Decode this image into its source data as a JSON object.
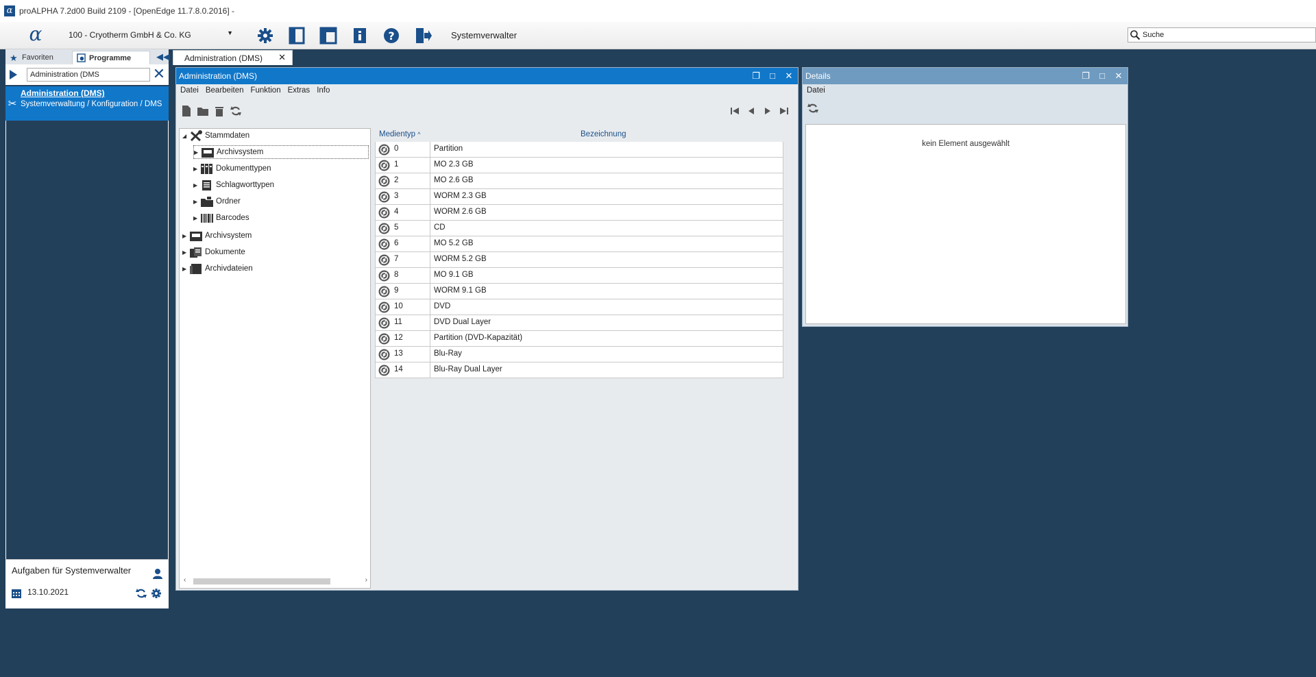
{
  "window": {
    "title": "proALPHA 7.2d00 Build 2109 - [OpenEdge 11.7.8.0.2016] -",
    "app_icon": "alpha-icon"
  },
  "toolbar": {
    "logo": "α",
    "company": "100 - Cryotherm GmbH & Co. KG",
    "role": "Systemverwalter",
    "search_label": "Suche",
    "icons": [
      "gear-icon",
      "panel-icon",
      "layout-icon",
      "info-icon",
      "help-icon",
      "exit-icon"
    ]
  },
  "left_panel": {
    "tabs": [
      {
        "label": "Favoriten",
        "icon": "star-icon"
      },
      {
        "label": "Programme",
        "icon": "programs-icon"
      }
    ],
    "search_value": "Administration (DMS",
    "result": {
      "title": "Administration (DMS)",
      "path": "Systemverwaltung / Konfiguration / DMS"
    },
    "tasks": {
      "title": "Aufgaben für Systemverwalter",
      "date": "13.10.2021"
    }
  },
  "main_tab": {
    "label": "Administration (DMS)",
    "close": "✕"
  },
  "admin_window": {
    "title": "Administration (DMS)",
    "menu": [
      "Datei",
      "Bearbeiten",
      "Funktion",
      "Extras",
      "Info"
    ],
    "tree": {
      "root": "Stammdaten",
      "children": [
        "Archivsystem",
        "Dokumenttypen",
        "Schlagworttypen",
        "Ordner",
        "Barcodes"
      ],
      "top_level": [
        "Archivsystem",
        "Dokumente",
        "Archivdateien"
      ]
    },
    "grid": {
      "columns": [
        "Medientyp",
        "Bezeichnung"
      ],
      "sort_indicator": "^",
      "rows": [
        {
          "num": "0",
          "name": "Partition"
        },
        {
          "num": "1",
          "name": "MO 2.3 GB"
        },
        {
          "num": "2",
          "name": "MO 2.6 GB"
        },
        {
          "num": "3",
          "name": "WORM 2.3 GB"
        },
        {
          "num": "4",
          "name": "WORM 2.6 GB"
        },
        {
          "num": "5",
          "name": "CD"
        },
        {
          "num": "6",
          "name": "MO 5.2 GB"
        },
        {
          "num": "7",
          "name": "WORM 5.2 GB"
        },
        {
          "num": "8",
          "name": "MO 9.1 GB"
        },
        {
          "num": "9",
          "name": "WORM 9.1 GB"
        },
        {
          "num": "10",
          "name": "DVD"
        },
        {
          "num": "11",
          "name": "DVD Dual Layer"
        },
        {
          "num": "12",
          "name": "Partition (DVD-Kapazität)"
        },
        {
          "num": "13",
          "name": "Blu-Ray"
        },
        {
          "num": "14",
          "name": "Blu-Ray Dual Layer"
        }
      ]
    }
  },
  "details_window": {
    "title": "Details",
    "menu": [
      "Datei"
    ],
    "empty_message": "kein Element ausgewählt"
  },
  "colors": {
    "accent": "#1177c9",
    "background": "#23405a",
    "icon_blue": "#1a4f8a"
  }
}
